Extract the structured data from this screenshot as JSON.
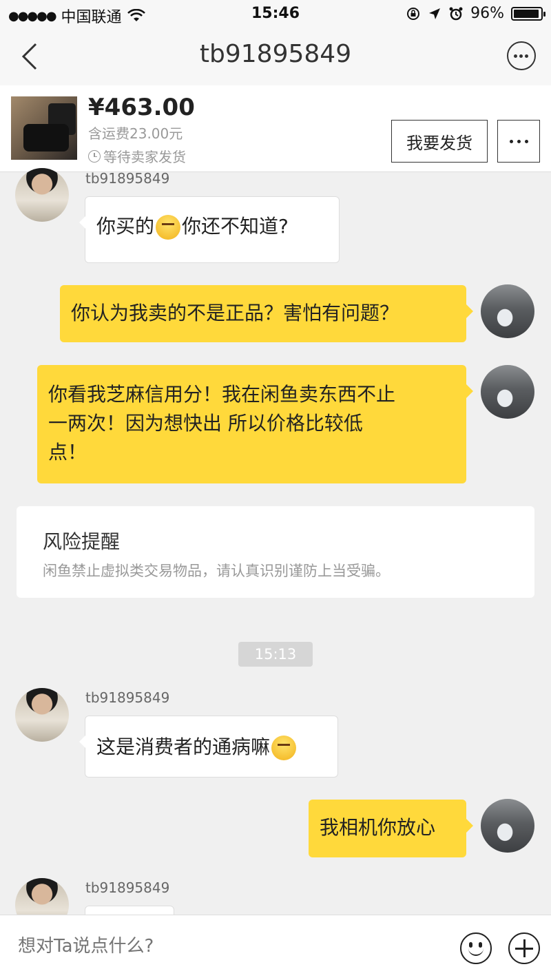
{
  "status_bar": {
    "signal": "●●●●●",
    "carrier": "中国联通",
    "time": "15:46",
    "battery": "96%",
    "battery_level": 0.96
  },
  "nav": {
    "title": "tb91895849",
    "icons": [
      "back-chevron-icon",
      "more-circle-icon"
    ]
  },
  "product": {
    "price": "¥463.00",
    "shipping": "含运费23.00元",
    "status": "等待卖家发货",
    "ship_button": "我要发货"
  },
  "messages": [
    {
      "sender": "tb91895849",
      "side": "left",
      "text_before": "你买的",
      "emoji": "unamused-face",
      "text_after": "你还不知道?"
    },
    {
      "side": "right",
      "text": "你认为我卖的不是正品？害怕有问题？"
    },
    {
      "side": "right",
      "lines": [
        "你看我芝麻信用分！我在闲鱼卖东西不止",
        "一两次！因为想快出  所以价格比较低",
        "点！"
      ]
    },
    {
      "risk_title": "风险提醒",
      "risk_text": "闲鱼禁止虚拟类交易物品，请认真识别谨防上当受骗。"
    },
    {
      "time_divider": "15:13"
    },
    {
      "sender": "tb91895849",
      "side": "left",
      "text": "这是消费者的通病嘛",
      "emoji": "grimacing-face"
    },
    {
      "side": "right",
      "text": "我相机你放心"
    },
    {
      "sender": "tb91895849",
      "side": "left",
      "text": ""
    }
  ],
  "input": {
    "placeholder": "想对Ta说点什么?"
  }
}
